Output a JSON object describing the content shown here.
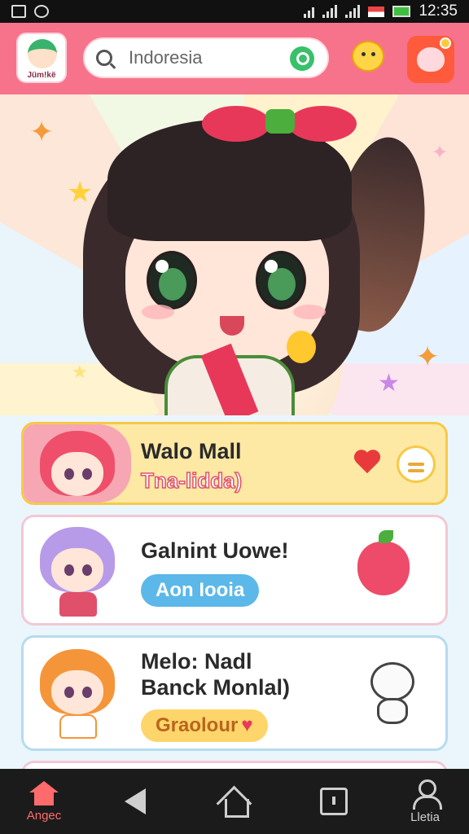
{
  "status_bar": {
    "time": "12:35",
    "icons": [
      "image-icon",
      "notification-icon",
      "wifi-icon",
      "signal-icon",
      "signal-icon",
      "flag-icon",
      "battery-icon"
    ]
  },
  "header": {
    "logo_text": "Jüm!kë",
    "search": {
      "value": "Indoresia",
      "icon": "search-icon",
      "go_icon": "search-go-icon"
    },
    "buttons": [
      {
        "icon": "chick-sticker-icon"
      },
      {
        "icon": "notification-mascot-icon"
      }
    ],
    "colors": {
      "header_bg": "#f7738b",
      "accent_green": "#39c06b"
    }
  },
  "cards": [
    {
      "title": "Walo Mall",
      "subtitle": "Tna-lidda)",
      "icons": [
        "heart-icon",
        "chat-icon"
      ]
    },
    {
      "title": "Galnint Uowe!",
      "button": "Aon Iooia",
      "icons": [
        "apple-sticker-icon"
      ]
    },
    {
      "title_line1": "Melo: Nadl",
      "title_line2": "Banck Monlal)",
      "button": "Graolour",
      "button_suffix": "♥",
      "icons": [
        "bear-sticker-icon"
      ]
    }
  ],
  "nav": {
    "items": [
      {
        "label": "Angec",
        "icon": "home-icon",
        "active": true
      },
      {
        "label": "",
        "icon": "back-icon"
      },
      {
        "label": "",
        "icon": "home-outline-icon"
      },
      {
        "label": "",
        "icon": "recent-apps-icon"
      },
      {
        "label": "Lletia",
        "icon": "profile-icon"
      }
    ],
    "active_color": "#ff6b6b"
  }
}
